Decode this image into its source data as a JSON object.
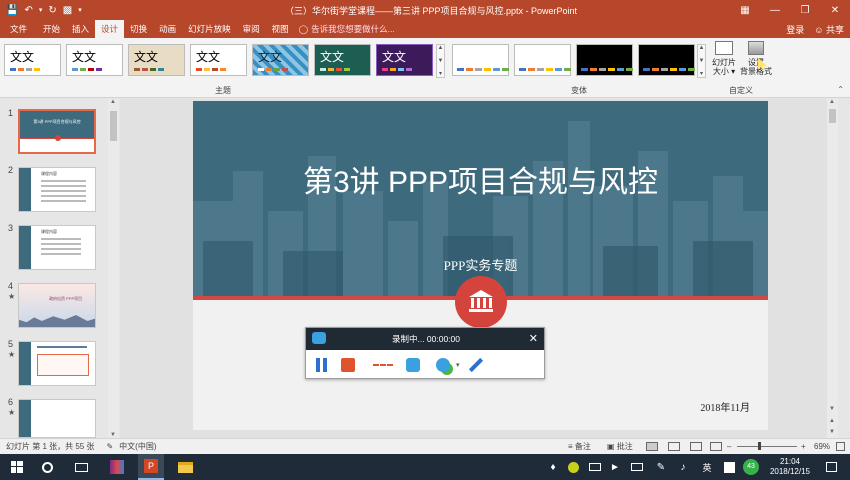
{
  "titlebar": {
    "window_title": "（三）华尔街学堂课程——第三讲 PPP项目合规与风控.pptx - PowerPoint",
    "brand_color": "#b7472a"
  },
  "tabs": [
    {
      "label": "文件"
    },
    {
      "label": "开始"
    },
    {
      "label": "插入"
    },
    {
      "label": "设计"
    },
    {
      "label": "切换"
    },
    {
      "label": "动画"
    },
    {
      "label": "幻灯片放映"
    },
    {
      "label": "审阅"
    },
    {
      "label": "视图"
    }
  ],
  "tell_me": "告诉我您想要做什么...",
  "account": {
    "login": "登录",
    "share": "共享"
  },
  "ribbon": {
    "themes_label": "主题",
    "variants_label": "变体",
    "customize_label": "自定义",
    "theme_text": "文文",
    "theme_text_alt": "文文",
    "slide_size_label": "幻灯片",
    "slide_size_label2": "大小",
    "format_bg_label": "设置",
    "format_bg_label2": "背景格式"
  },
  "thumbnails": [
    {
      "number": "1",
      "star": "",
      "mini_title": "第3讲 PPP项目合规与风控"
    },
    {
      "number": "2",
      "star": "",
      "mini_title": "课程内容"
    },
    {
      "number": "3",
      "star": "",
      "mini_title": "课程内容"
    },
    {
      "number": "4",
      "star": "★",
      "mini_title": "政府出资 PPP项目"
    },
    {
      "number": "5",
      "star": "★",
      "mini_title": ""
    },
    {
      "number": "6",
      "star": "★",
      "mini_title": ""
    }
  ],
  "slide": {
    "title": "第3讲  PPP项目合规与风控",
    "subtitle": "PPP实务专题",
    "date": "2018年11月"
  },
  "recorder": {
    "status": "录制中... 00:00:00",
    "close": "✕"
  },
  "statusbar": {
    "slide_info": "幻灯片 第 1 张，共 55 张",
    "language": "中文(中国)",
    "notes": "备注",
    "comments": "批注",
    "zoom": "69%",
    "zoom_level": 0.69
  },
  "taskbar": {
    "time": "21:04",
    "date": "2018/12/15",
    "ime": "英",
    "badge": "43"
  }
}
